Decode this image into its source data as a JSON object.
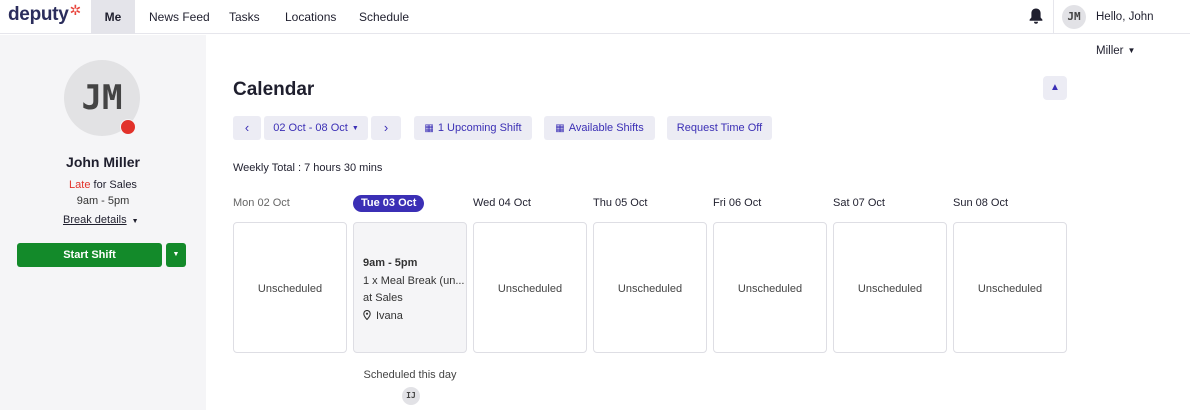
{
  "nav": {
    "logo": "deputy",
    "logo_star": "✲",
    "items": [
      {
        "label": "Me",
        "active": true
      },
      {
        "label": "News Feed"
      },
      {
        "label": "Tasks"
      },
      {
        "label": "Locations"
      },
      {
        "label": "Schedule"
      }
    ],
    "user_initials": "JM",
    "greeting": "Hello, John Miller",
    "icons": {
      "notifications": "bell-icon",
      "menu": "chevron-down-icon"
    }
  },
  "profile": {
    "initials": "JM",
    "status_color": "#e2322b",
    "name": "John Miller",
    "status_word": "Late",
    "status_rest": " for Sales",
    "shift_time": "9am - 5pm",
    "break_details": "Break details",
    "start_shift": "Start Shift"
  },
  "calendar": {
    "title": "Calendar",
    "date_range": "02 Oct - 08 Oct",
    "upcoming_shift": "1 Upcoming Shift",
    "available_shifts": "Available Shifts",
    "request_time_off": "Request Time Off",
    "weekly_total": "Weekly Total : 7 hours 30 mins",
    "unscheduled_label": "Unscheduled",
    "days": [
      {
        "label": "Mon 02 Oct",
        "state": "past"
      },
      {
        "label": "Tue 03 Oct",
        "state": "today"
      },
      {
        "label": "Wed 04 Oct"
      },
      {
        "label": "Thu 05 Oct"
      },
      {
        "label": "Fri 06 Oct"
      },
      {
        "label": "Sat 07 Oct"
      },
      {
        "label": "Sun 08 Oct"
      }
    ],
    "shift": {
      "time": "9am - 5pm",
      "meal": "1 x Meal Break (un...",
      "area": "at Sales",
      "location": "Ivana"
    },
    "scheduled_this_day": "Scheduled this day",
    "scheduled_initials": "IJ"
  },
  "colors": {
    "accent": "#3b2fb5",
    "start_button": "#138a2a",
    "late": "#e2322b"
  }
}
